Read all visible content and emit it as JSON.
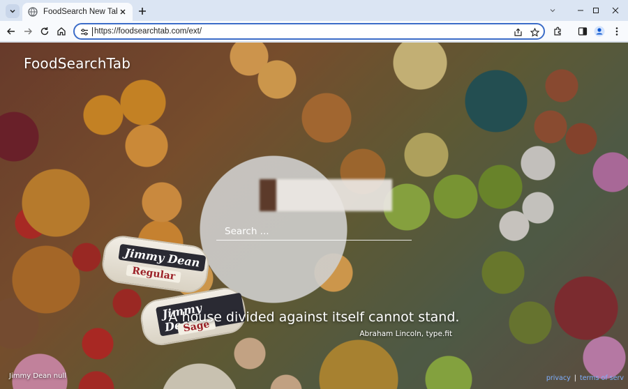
{
  "browser": {
    "tab_title": "FoodSearch New Tab",
    "url": "https://foodsearchtab.com/ext/"
  },
  "page": {
    "logo": "FoodSearchTab",
    "search": {
      "placeholder": "Search ..."
    },
    "quote": {
      "text": "A house divided against itself cannot stand.",
      "source": "Abraham Lincoln, type.fit"
    },
    "photo_credit": "Jimmy Dean null",
    "footer": {
      "privacy": "privacy",
      "separator": "|",
      "terms": "terms of serv"
    },
    "packages": [
      {
        "brand": "Jimmy Dean",
        "variety": "Regular"
      },
      {
        "brand": "Jimmy Dean",
        "variety": "Sage"
      }
    ]
  },
  "colors": {
    "accent": "#3b6cc8",
    "link": "#7fb0ff",
    "tabstrip": "#dbe5f3"
  },
  "icons": [
    "tab-list-icon",
    "globe-icon",
    "close-icon",
    "plus-icon",
    "minimize-icon",
    "maximize-icon",
    "window-close-icon",
    "back-icon",
    "forward-icon",
    "reload-icon",
    "home-icon",
    "site-settings-icon",
    "share-icon",
    "star-icon",
    "extensions-icon",
    "sidepanel-icon",
    "profile-icon",
    "menu-icon"
  ]
}
